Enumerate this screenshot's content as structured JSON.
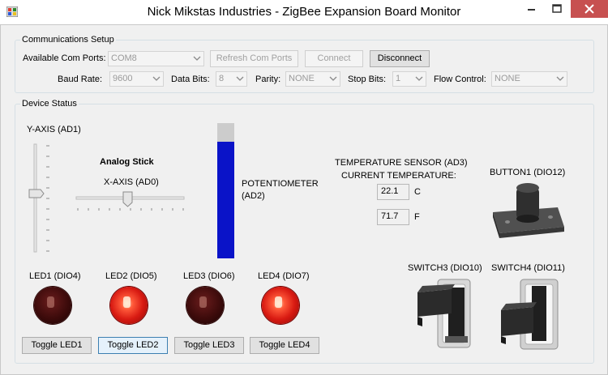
{
  "window": {
    "title": "Nick Mikstas Industries - ZigBee Expansion Board Monitor"
  },
  "communications": {
    "group_label": "Communications Setup",
    "com_ports_label": "Available Com Ports:",
    "com_port_value": "COM8",
    "refresh_label": "Refresh Com Ports",
    "connect_label": "Connect",
    "disconnect_label": "Disconnect",
    "baud_label": "Baud Rate:",
    "baud_value": "9600",
    "databits_label": "Data Bits:",
    "databits_value": "8",
    "parity_label": "Parity:",
    "parity_value": "NONE",
    "stopbits_label": "Stop Bits:",
    "stopbits_value": "1",
    "flow_label": "Flow Control:",
    "flow_value": "NONE"
  },
  "device": {
    "group_label": "Device Status",
    "y_axis_label": "Y-AXIS (AD1)",
    "y_axis_level": 0.5,
    "analog_stick_label": "Analog Stick",
    "x_axis_label": "X-AXIS (AD0)",
    "x_axis_level": 0.5,
    "potentiometer_label": "POTENTIOMETER\n(AD2)",
    "potentiometer_level": 0.86,
    "temp_label_1": "TEMPERATURE SENSOR (AD3)",
    "temp_label_2": "CURRENT TEMPERATURE:",
    "temp_c": "22.1",
    "temp_c_unit": "C",
    "temp_f": "71.7",
    "temp_f_unit": "F",
    "button1_label": "BUTTON1 (DIO12)",
    "switch3_label": "SWITCH3 (DIO10)",
    "switch4_label": "SWITCH4 (DIO11)",
    "leds": [
      {
        "label": "LED1 (DIO4)",
        "state": "off",
        "button": "Toggle LED1"
      },
      {
        "label": "LED2 (DIO5)",
        "state": "on",
        "button": "Toggle LED2"
      },
      {
        "label": "LED3 (DIO6)",
        "state": "off",
        "button": "Toggle LED3"
      },
      {
        "label": "LED4 (DIO7)",
        "state": "on",
        "button": "Toggle LED4"
      }
    ]
  },
  "colors": {
    "potentiometer_fill": "#0a13c8",
    "potentiometer_track": "#cccccc",
    "close_button": "#c75050"
  }
}
